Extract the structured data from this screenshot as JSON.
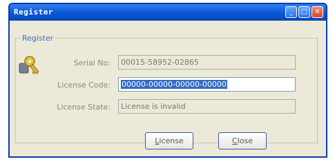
{
  "window": {
    "title": "Register",
    "buttons": {
      "minimize": "_",
      "maximize": "□",
      "close": "✕"
    }
  },
  "group": {
    "title": "Register"
  },
  "fields": {
    "serial_label": "Serial No:",
    "serial_value": "00015-58952-02865",
    "license_code_label": "License Code:",
    "license_code_value": "00000-00000-00000-00000",
    "license_state_label": "License State:",
    "license_state_value": "License is invalid"
  },
  "buttons": {
    "license_mnemonic": "L",
    "license_rest": "icense",
    "close_mnemonic": "C",
    "close_rest": "lose"
  },
  "icons": {
    "app_icon": "key-icon"
  },
  "colors": {
    "titlebar": "#0a57d6",
    "selection": "#316ac5",
    "group_title": "#3e6cc4"
  }
}
